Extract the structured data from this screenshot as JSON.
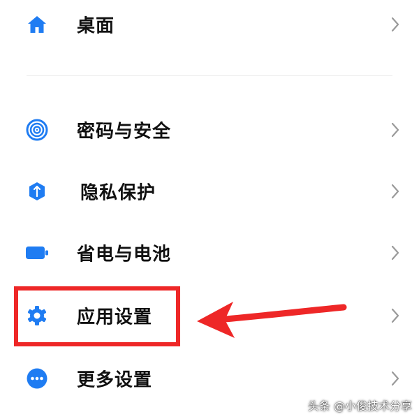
{
  "settings": {
    "items": [
      {
        "label": "桌面",
        "icon": "home-icon"
      },
      {
        "label": "密码与安全",
        "icon": "fingerprint-icon"
      },
      {
        "label": "隐私保护",
        "icon": "privacy-shield-icon"
      },
      {
        "label": "省电与电池",
        "icon": "battery-icon"
      },
      {
        "label": "应用设置",
        "icon": "gear-icon"
      },
      {
        "label": "更多设置",
        "icon": "more-dots-icon"
      }
    ]
  },
  "annotation": {
    "highlight_color": "#ee2727",
    "highlighted_item": "应用设置"
  },
  "colors": {
    "icon_accent": "#1f7cf2",
    "chevron": "#9a9a9a",
    "text": "#111111"
  },
  "watermark": {
    "text": "头条 @小俊技术分享"
  }
}
